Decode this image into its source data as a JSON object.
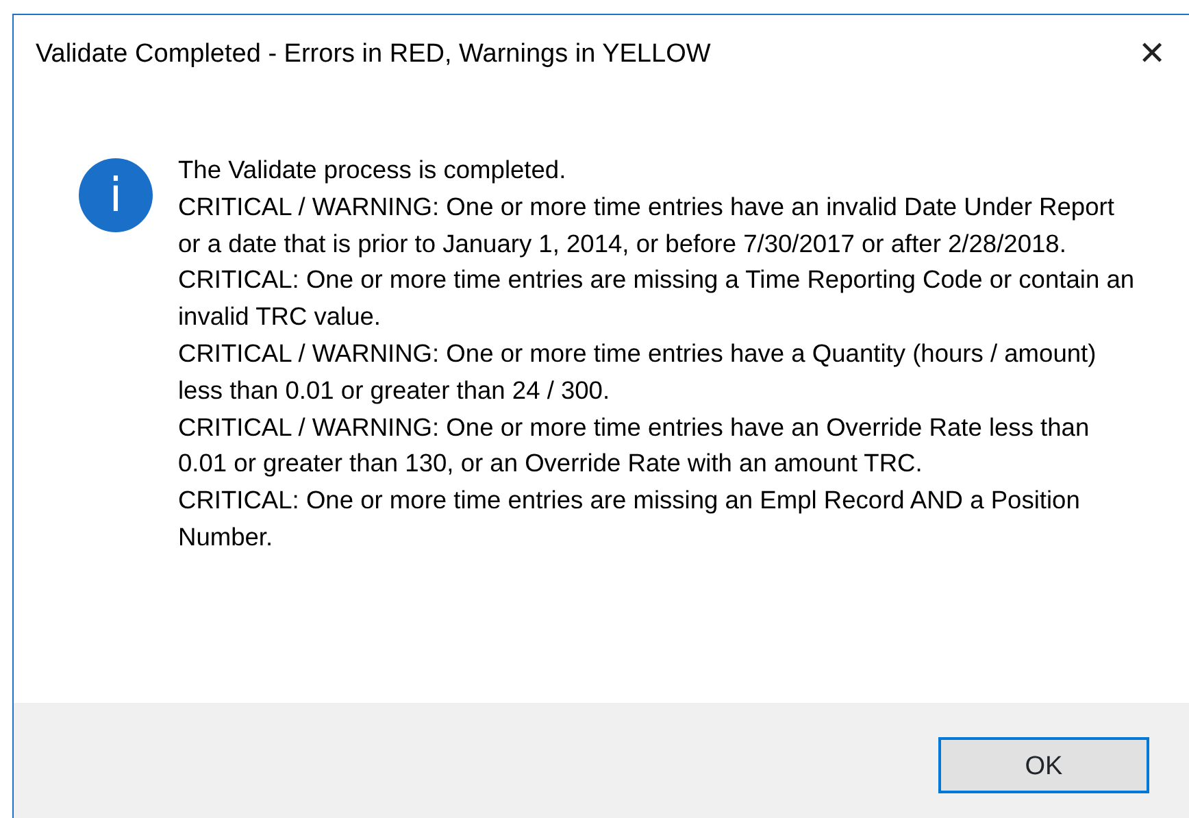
{
  "window": {
    "title": "Validate Completed - Errors in RED, Warnings in YELLOW",
    "close": "✕"
  },
  "message": {
    "icon": "i",
    "lines": [
      "The Validate process is completed.",
      "CRITICAL / WARNING: One or more time entries have an invalid Date Under Report or a date that is prior to January 1, 2014, or before 7/30/2017 or after 2/28/2018.",
      "CRITICAL: One or more time entries are missing a Time Reporting Code or contain an invalid TRC value.",
      "CRITICAL / WARNING: One or more time entries have a Quantity (hours / amount) less than 0.01 or greater than 24 / 300.",
      "CRITICAL / WARNING: One or more time entries have an Override Rate less than 0.01 or greater than 130, or an Override Rate with an amount TRC.",
      "CRITICAL: One or more time entries are missing an Empl Record AND a Position Number."
    ]
  },
  "buttons": [
    {
      "label": "OK",
      "selected": true
    }
  ]
}
